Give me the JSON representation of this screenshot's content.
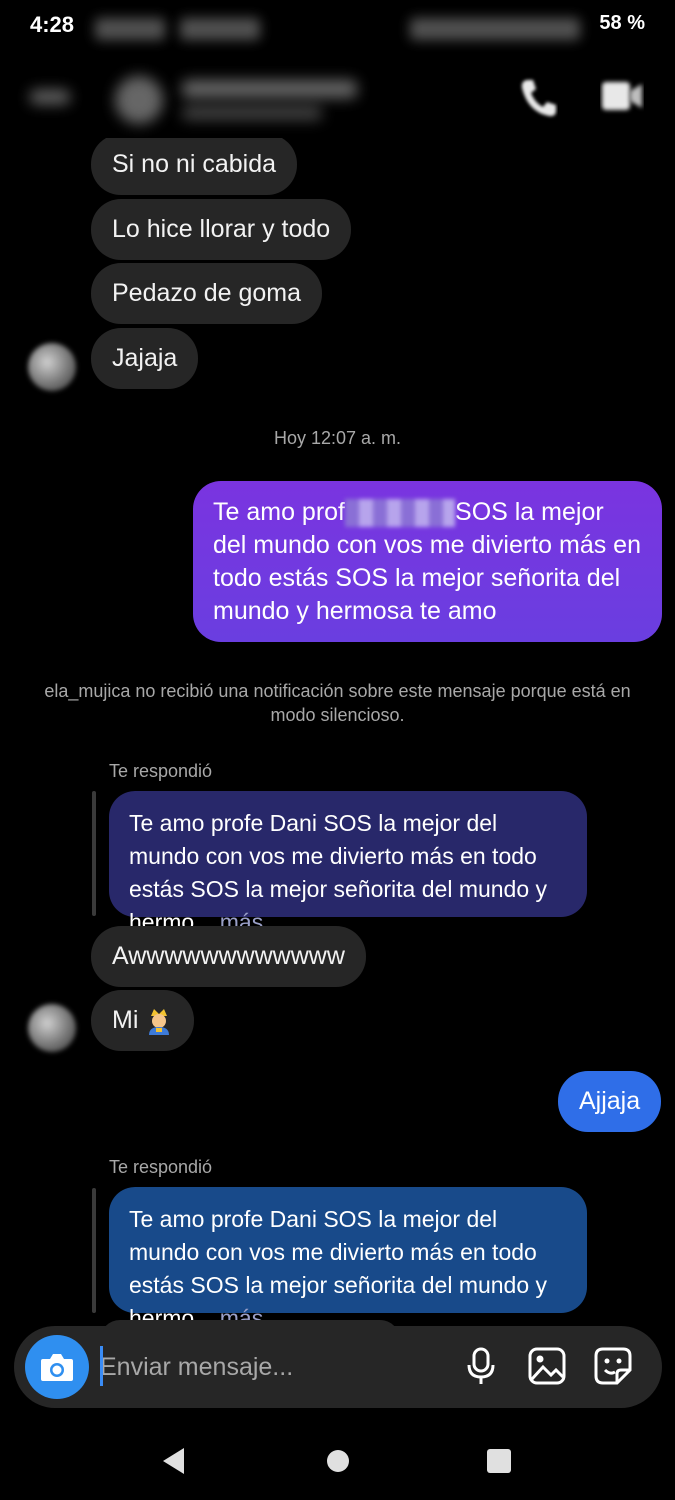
{
  "status": {
    "time": "4:28",
    "battery": "58 %"
  },
  "messages": {
    "m1": "Si no ni cabida",
    "m2": "Lo hice llorar y todo",
    "m3": "Pedazo de goma",
    "m4": "Jajaja",
    "timestamp": "Hoy 12:07 a. m.",
    "sent_part1": "Te amo prof",
    "sent_part2": "SOS la mejor del mundo con vos me divierto más en todo estás SOS la mejor señorita del mundo y hermosa te amo",
    "notice": "ela_mujica no recibió una notificación sobre este mensaje porque está en modo silencioso.",
    "reply1_label": "Te respondió",
    "reply1_quote": "Te amo profe Dani SOS la mejor del mundo con vos me divierto más en todo estás SOS la mejor señorita del mundo y hermo",
    "reply1_more": "... más",
    "m5": "Awwwwwwwwwwww",
    "m6": "Mi",
    "m6_emoji": "person-with-crown-emoji",
    "sent2": "Ajjaja",
    "reply2_label": "Te respondió",
    "reply2_quote": "Te amo profe Dani SOS la mejor del mundo con vos me divierto más en todo estás SOS la mejor señorita del mundo y hermo",
    "reply2_more": "... más"
  },
  "composer": {
    "placeholder": "Enviar mensaje..."
  },
  "colors": {
    "accent": "#2f8ff0",
    "sent_purple": "#7a34e0",
    "sent_blue": "#2f6ee8",
    "incoming": "#262626"
  },
  "icons": [
    "phone-icon",
    "video-icon",
    "camera-icon",
    "microphone-icon",
    "gallery-icon",
    "sticker-icon",
    "back-nav-icon",
    "home-nav-icon",
    "recents-nav-icon"
  ]
}
